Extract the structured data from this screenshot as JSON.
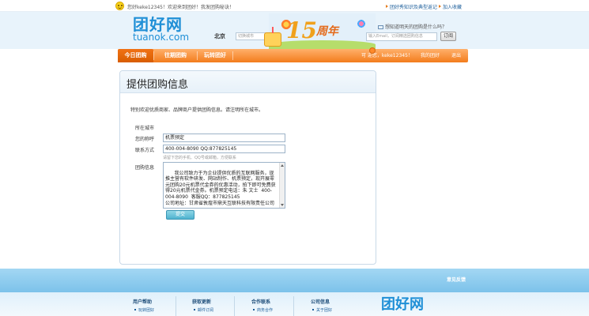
{
  "topbar": {
    "greeting": "您好keke12345！欢迎来到团好！我发团购秘诀！",
    "link_tuangou": "团好秀知识及典型返记",
    "link_fav": "加入收藏"
  },
  "header": {
    "logo_cn": "团好网",
    "logo_en": "tuanok.com",
    "city": "北京",
    "city_input_placeholder": "切换城市",
    "anniv_number": "15",
    "anniv_suffix": "周年",
    "subscribe_question": "想知道明天的团购是什么吗？",
    "subscribe_placeholder": "输入Email，订阅精选团购信息",
    "subscribe_button": "订阅"
  },
  "nav": {
    "tabs": [
      {
        "label": "今日团购"
      },
      {
        "label": "往期团购"
      },
      {
        "label": "玩转团好"
      }
    ],
    "welcome": "可 迎您，keke12345！",
    "my_orders": "我的团好",
    "logout": "退出"
  },
  "form": {
    "title": "提供团购信息",
    "intro": "特别欢迎优质商家、品牌商户提供团购信息。请注明所在城市。",
    "city_label": "所在城市",
    "name_label": "您的称呼",
    "name_value": "机票预定",
    "contact_label": "联系方式",
    "contact_value": "400-004-8090 QQ:877825145",
    "contact_hint": "请留下您的手机、QQ号或邮箱，方便联系",
    "info_label": "团购信息",
    "info_value": "  我公司致力于为企业提供优质的互联网服务，现推主营有软件研发、网站制作、机票预定，现开展零元团购20元机票代金券的优惠活动，拍下即可免费获得20元机票代金券。机票预定电话：朱 文士  400-004-8090  客服QQ：877825145\n公司地址：甘肃省敦煌市鼎天互联科技有限责任公司",
    "submit_label": "提交"
  },
  "footer": {
    "feedback": "意见反馈",
    "columns": [
      {
        "title": "用户帮助",
        "item": "玩转团好"
      },
      {
        "title": "获取更新",
        "item": "邮件订阅"
      },
      {
        "title": "合作联系",
        "item": "商务合作"
      },
      {
        "title": "公司信息",
        "item": "关于团好"
      }
    ],
    "logo": "团好网"
  }
}
